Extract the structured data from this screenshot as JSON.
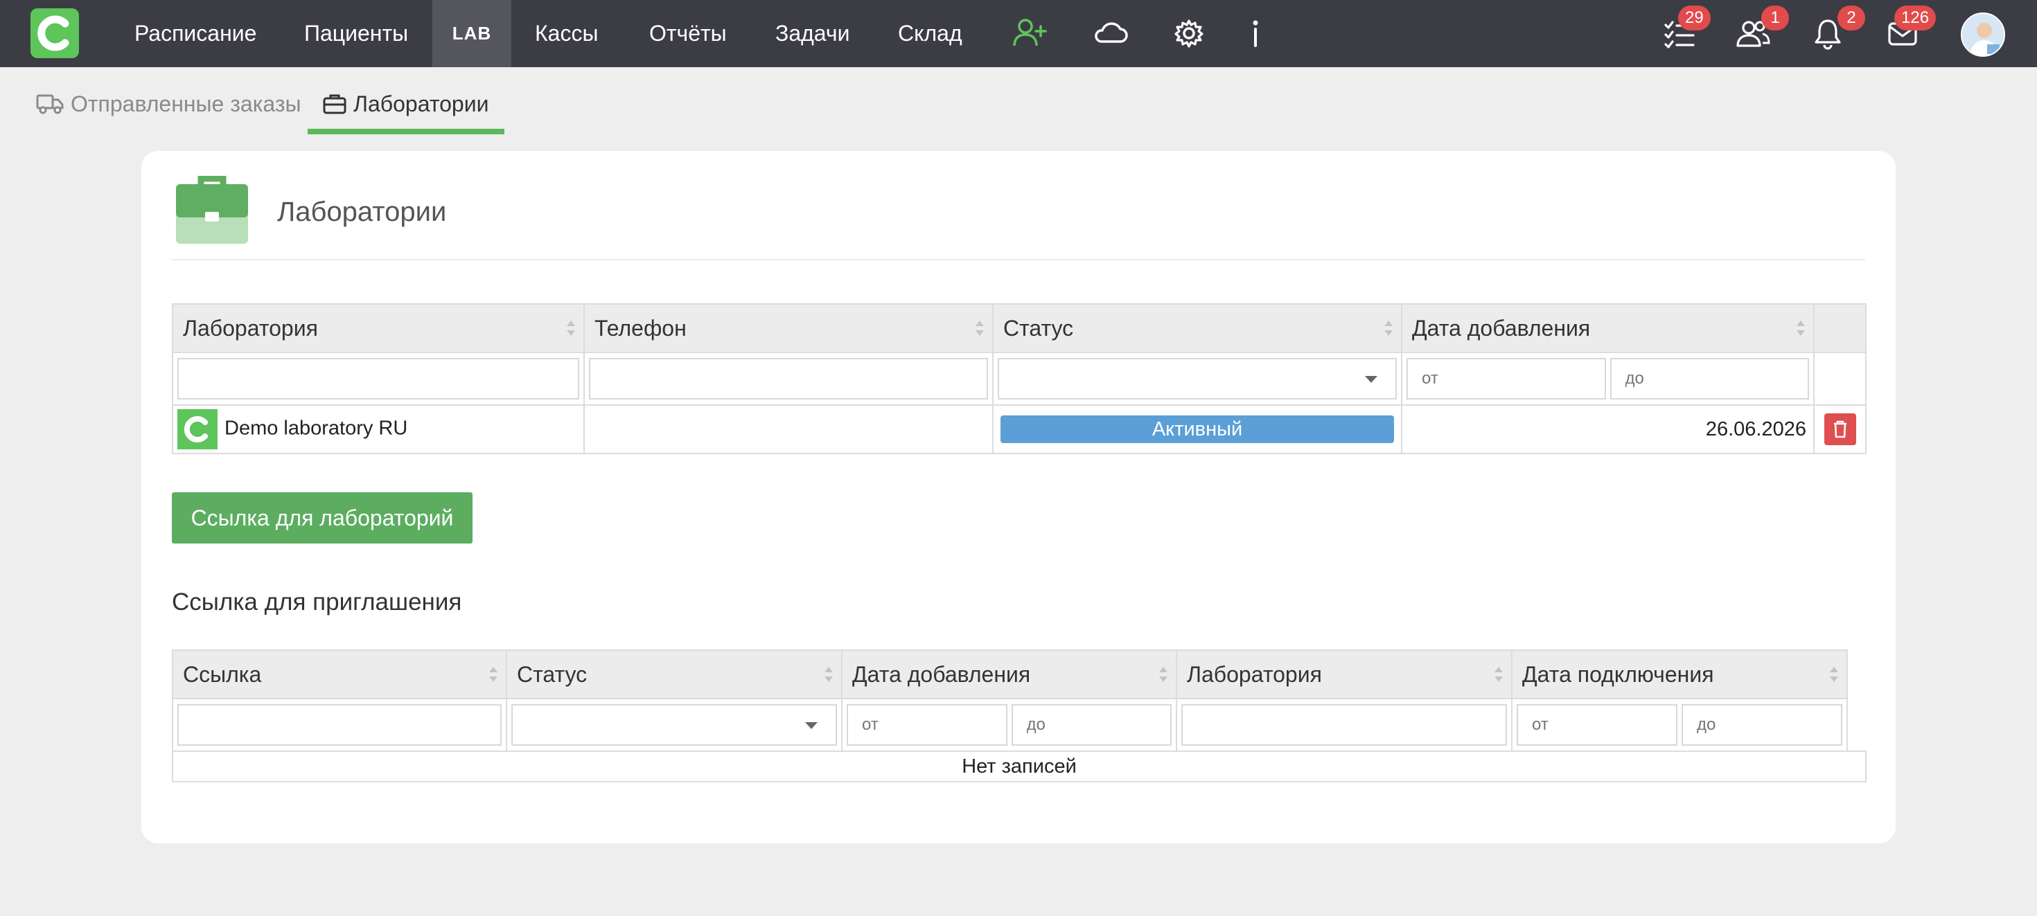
{
  "nav": {
    "items": [
      "Расписание",
      "Пациенты",
      "LAB",
      "Кассы",
      "Отчёты",
      "Задачи",
      "Склад"
    ],
    "badges": {
      "tasks": "29",
      "users": "1",
      "notifications": "2",
      "messages": "126"
    },
    "icons": [
      "add-user-icon",
      "cloud-icon",
      "gear-icon",
      "info-icon",
      "checklist-icon",
      "users-icon",
      "bell-icon",
      "envelope-icon"
    ]
  },
  "subtabs": [
    "Отправленные заказы",
    "Лаборатории"
  ],
  "card": {
    "title": "Лаборатории"
  },
  "labs_table": {
    "columns": [
      "Лаборатория",
      "Телефон",
      "Статус",
      "Дата добавления"
    ],
    "filters": {
      "date_from": "от",
      "date_to": "до"
    },
    "rows": [
      {
        "name": "Demo laboratory RU",
        "phone": "",
        "status": "Активный",
        "date": "26.06.2026"
      }
    ]
  },
  "link_button": "Ссылка для лабораторий",
  "invite_section": {
    "title": "Ссылка для приглашения",
    "columns": [
      "Ссылка",
      "Статус",
      "Дата добавления",
      "Лаборатория",
      "Дата подключения"
    ],
    "filters": {
      "date_from": "от",
      "date_to": "до"
    },
    "empty": "Нет записей"
  },
  "colors": {
    "topbar": "#3c3c44",
    "accent": "#5cb85c",
    "status_active": "#5b9fd6",
    "danger": "#df4f4f",
    "badge": "#e24b4b"
  }
}
